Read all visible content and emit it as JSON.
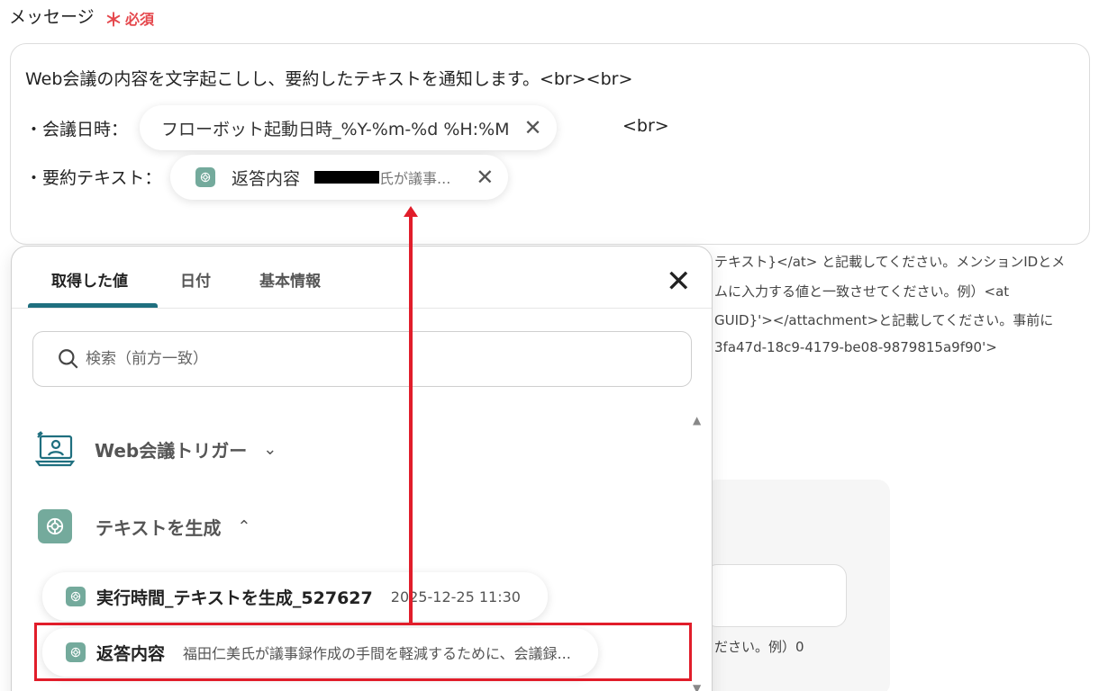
{
  "field": {
    "label": "メッセージ",
    "required_mark": "＊",
    "required_text": "必須"
  },
  "message": {
    "line1": "Web会議の内容を文字起こしし、要約したテキストを通知します。<br><br>",
    "line2_prefix": "・会議日時：",
    "line2_chip": "フローボット起動日時_%Y-%m-%d %H:%M",
    "line2_suffix": "<br>",
    "line3_prefix": "・要約テキスト：",
    "line3_chip_label": "返答内容",
    "line3_chip_preview": "氏が議事..."
  },
  "background_help": {
    "line1": "テキスト}</at> と記載してください。メンションIDとメ",
    "line2": "ムに入力する値と一致させてください。例）<at",
    "line3": "GUID}'></attachment>と記載してください。事前に",
    "line4": "3fa47d-18c9-4179-be08-9879815a9f90'>",
    "tail": "ださい。例）0"
  },
  "popup": {
    "tabs": [
      "取得した値",
      "日付",
      "基本情報"
    ],
    "close_label": "✕",
    "search_placeholder": "検索（前方一致）",
    "sections": [
      {
        "label": "Web会議トリガー",
        "chevron": "⌄"
      },
      {
        "label": "テキストを生成",
        "chevron": "⌃"
      }
    ],
    "items": [
      {
        "label": "実行時間_テキストを生成_527627",
        "value": "2025-12-25 11:30"
      },
      {
        "label": "返答内容",
        "value": "福田仁美氏が議事録作成の手間を軽減するために、会議録..."
      }
    ]
  },
  "colors": {
    "accent": "#1f6f7f",
    "required": "#e5484d",
    "annotation": "#e11d2a",
    "openai_tile": "#74aa9c"
  },
  "icons": [
    "openai-icon",
    "search-icon",
    "close-icon",
    "web-meeting-icon",
    "chevron-down-icon",
    "chevron-up-icon"
  ]
}
